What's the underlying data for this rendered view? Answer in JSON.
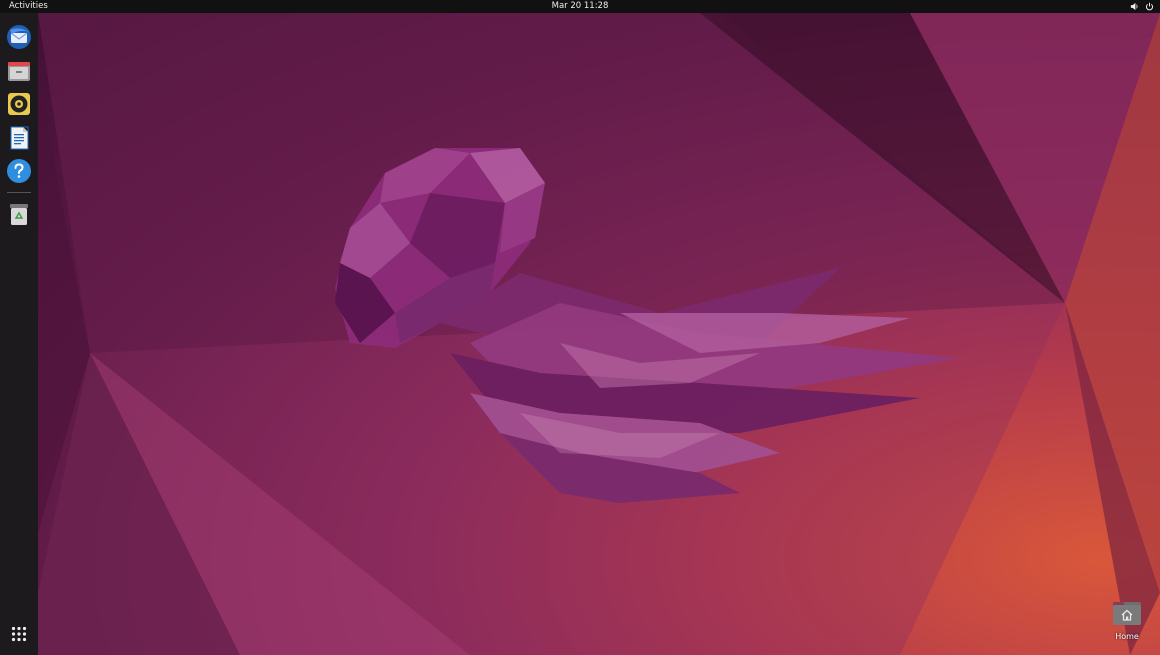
{
  "topbar": {
    "activities_label": "Activities",
    "clock": "Mar 20  11:28",
    "tray": {
      "volume_icon": "volume-icon",
      "power_icon": "power-icon"
    }
  },
  "dock": {
    "items": [
      {
        "name": "thunderbird",
        "icon": "mail-icon"
      },
      {
        "name": "files",
        "icon": "folder-icon"
      },
      {
        "name": "rhythmbox",
        "icon": "music-icon"
      },
      {
        "name": "libreoffice-writer",
        "icon": "document-icon"
      },
      {
        "name": "help",
        "icon": "help-icon"
      },
      {
        "name": "trash",
        "icon": "trash-icon"
      }
    ],
    "show_apps_icon": "app-grid-icon"
  },
  "desktop": {
    "home_label": "Home",
    "home_icon": "home-folder-icon"
  },
  "colors": {
    "topbar": "#111111",
    "dock": "#1c1a1c",
    "wallpaper_dark": "#3e0f34",
    "wallpaper_light": "#d9573a"
  }
}
